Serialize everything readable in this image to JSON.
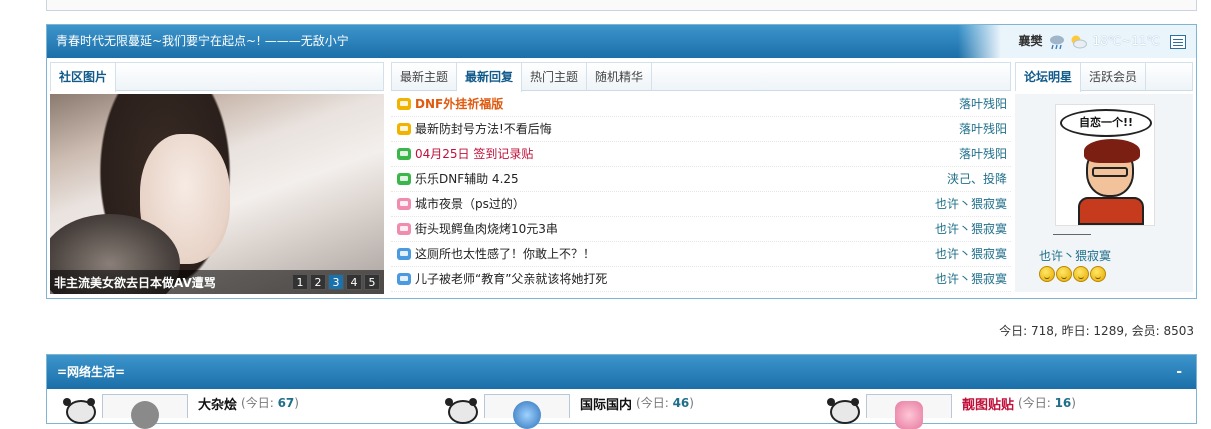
{
  "portal": {
    "marquee": "青春时代无限蔓延~我们要宁在起点~! ———无敌小宁",
    "weather": {
      "city": "襄樊",
      "temp": "18℃~11℃"
    },
    "left_tabs": [
      "社区图片"
    ],
    "photo_caption": "非主流美女欲去日本做AV遭骂",
    "photo_pages": [
      "1",
      "2",
      "3",
      "4",
      "5"
    ],
    "photo_active_page": 3,
    "mid_tabs": [
      "最新主题",
      "最新回复",
      "热门主题",
      "随机精华"
    ],
    "mid_active_tab": 1,
    "threads": [
      {
        "title": "DNF外挂祈福版",
        "author": "落叶残阳",
        "style": "hot",
        "icon_color": "#f0b400"
      },
      {
        "title": "最新防封号方法!不看后悔",
        "author": "落叶残阳",
        "style": "",
        "icon_color": "#f0b400"
      },
      {
        "title": "04月25日 签到记录贴",
        "author": "落叶残阳",
        "style": "red",
        "icon_color": "#3bb64a"
      },
      {
        "title": "乐乐DNF辅助 4.25",
        "author": "浃己、投降",
        "style": "",
        "icon_color": "#3bb64a"
      },
      {
        "title": "城市夜景（ps过的）",
        "author": "也许丶猥寂寞",
        "style": "",
        "icon_color": "#f08cb0"
      },
      {
        "title": "街头现鳄鱼肉烧烤10元3串",
        "author": "也许丶猥寂寞",
        "style": "",
        "icon_color": "#f08cb0"
      },
      {
        "title": "这厕所也太性感了！你敢上不？！",
        "author": "也许丶猥寂寞",
        "style": "",
        "icon_color": "#4a9ae0"
      },
      {
        "title": "儿子被老师“教育”父亲就该将她打死",
        "author": "也许丶猥寂寞",
        "style": "",
        "icon_color": "#4a9ae0"
      }
    ],
    "right_tabs": [
      "论坛明星",
      "活跃会员"
    ],
    "right_active_tab": 0,
    "star": {
      "bubble_text": "自恋一个!!",
      "names": "也许丶猥寂寞"
    }
  },
  "stats": "今日: 718, 昨日: 1289, 会员: 8503",
  "section": {
    "title": "=网络生活=",
    "collapse": "-",
    "forums": [
      {
        "name": "大杂烩",
        "today_label": "(今日:",
        "today_count": "67",
        "today_close": ")",
        "name_red": false
      },
      {
        "name": "国际国内",
        "today_label": "(今日:",
        "today_count": "46",
        "today_close": ")",
        "name_red": false
      },
      {
        "name": "靓图贴贴",
        "today_label": "(今日:",
        "today_count": "16",
        "today_close": ")",
        "name_red": true
      }
    ]
  }
}
